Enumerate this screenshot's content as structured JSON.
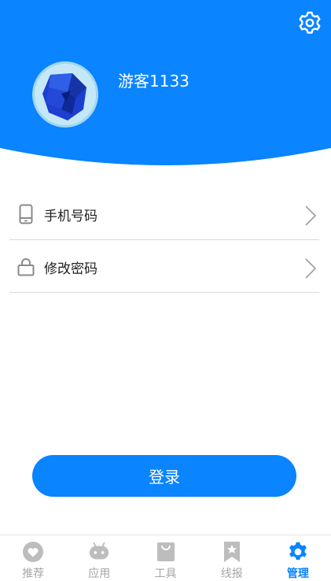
{
  "theme": {
    "primary": "#0a84ff",
    "inactive": "#bdbdbd",
    "active_tab": "#0a84ff"
  },
  "header": {
    "settings_icon": "gear-icon",
    "username": "游客1133"
  },
  "menu": [
    {
      "label": "手机号码",
      "icon": "phone-icon"
    },
    {
      "label": "修改密码",
      "icon": "lock-icon"
    }
  ],
  "login_label": "登录",
  "tabs": [
    {
      "label": "推荐",
      "icon": "heart-icon",
      "active": false
    },
    {
      "label": "应用",
      "icon": "gamepad-icon",
      "active": false
    },
    {
      "label": "工具",
      "icon": "bag-icon",
      "active": false
    },
    {
      "label": "线报",
      "icon": "bookmark-icon",
      "active": false
    },
    {
      "label": "管理",
      "icon": "gear-icon",
      "active": true
    }
  ]
}
